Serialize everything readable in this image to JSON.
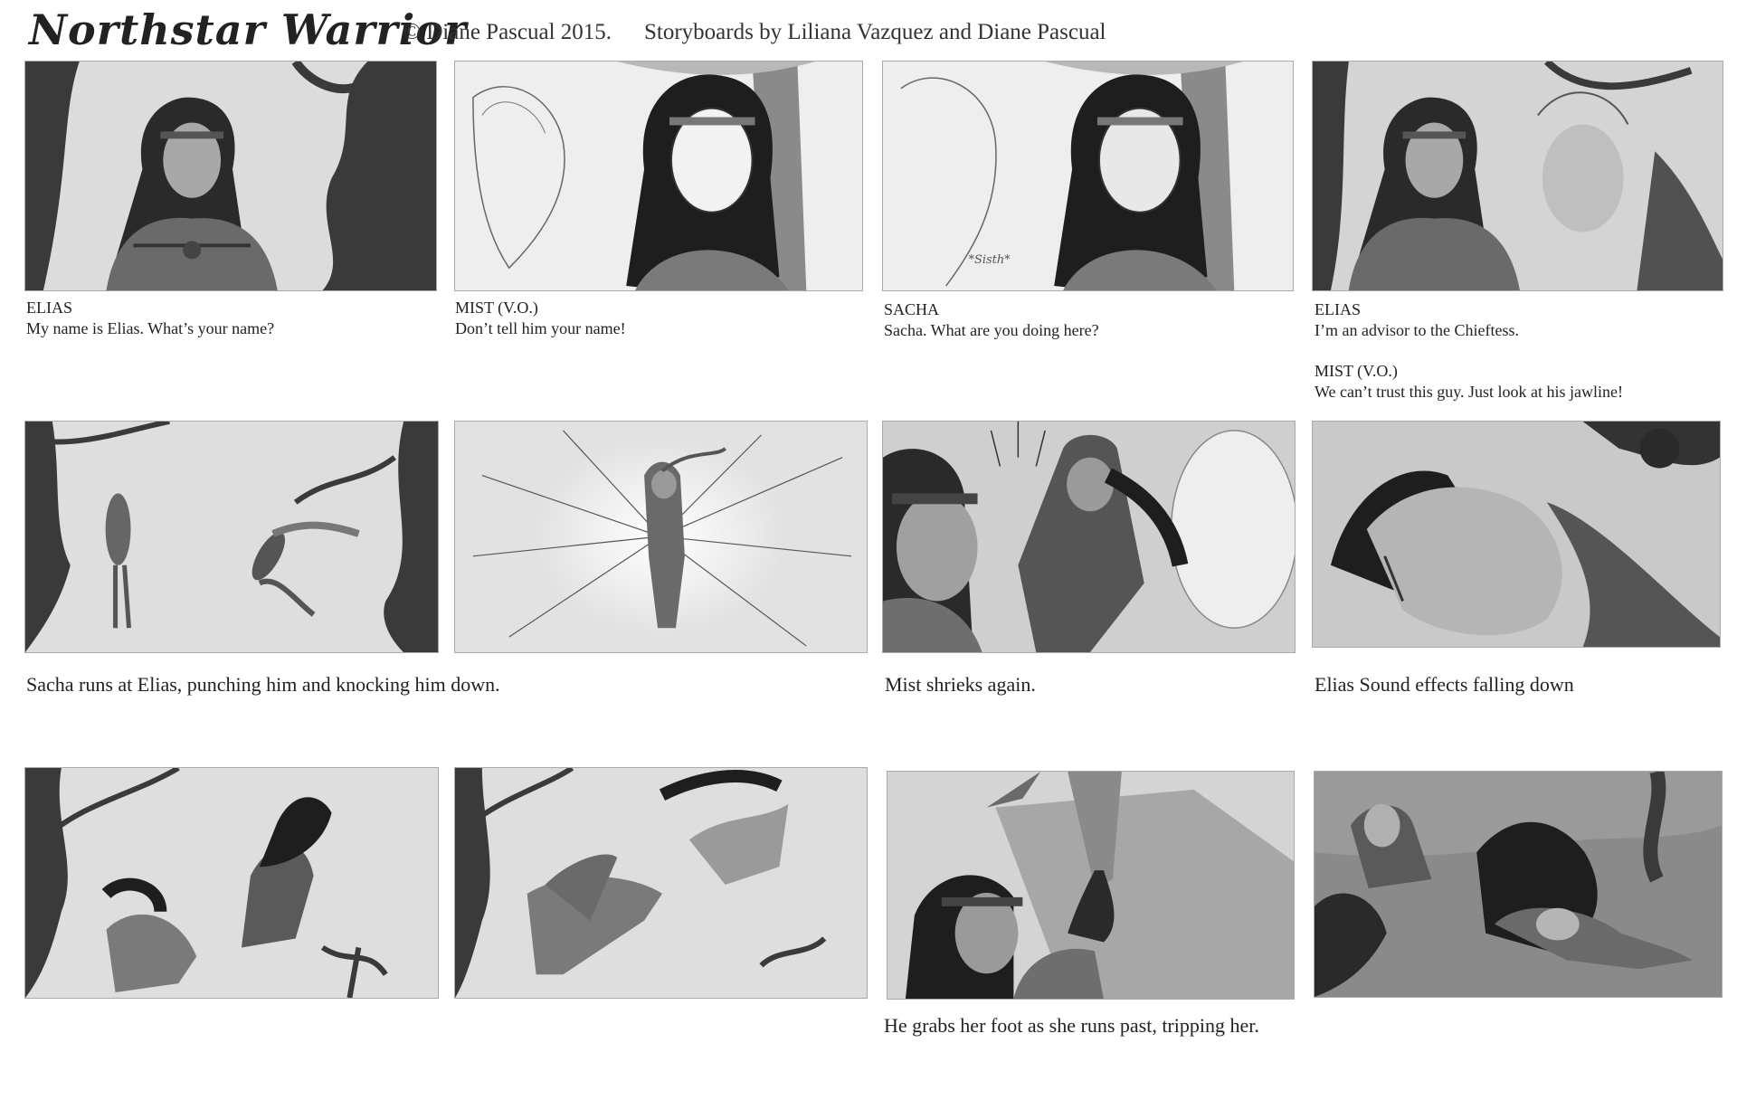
{
  "header": {
    "title": "Northstar Warrior",
    "copyright": "© Diane Pascual 2015.",
    "storyboard_credit": "Storyboards by Liliana Vazquez and Diane Pascual"
  },
  "row1": [
    {
      "speaker": "ELIAS",
      "line": "My name is Elias. What’s your name?"
    },
    {
      "speaker": "MIST (V.O.)",
      "line": "Don’t tell him your name!"
    },
    {
      "speaker": "SACHA",
      "line": "Sacha. What are you doing here?"
    },
    {
      "speaker": "ELIAS",
      "line": "I’m an advisor to the Chieftess.",
      "speaker2": "MIST (V.O.)",
      "line2": "We can’t trust this guy. Just look at his jawline!"
    }
  ],
  "row2": [
    {
      "caption": "Sacha runs at Elias, punching him and knocking him down."
    },
    {
      "caption": ""
    },
    {
      "caption": "Mist shrieks again."
    },
    {
      "caption": "Elias Sound effects falling down"
    }
  ],
  "row3": [
    {
      "caption": ""
    },
    {
      "caption": ""
    },
    {
      "caption": "He grabs her foot as she runs past, tripping her."
    },
    {
      "caption": ""
    }
  ],
  "panel_sketch_text": "*Sisth*",
  "colors": {
    "panel_bg": "#d9d9d9",
    "ink": "#222222",
    "tree": "#3a3a3a"
  }
}
